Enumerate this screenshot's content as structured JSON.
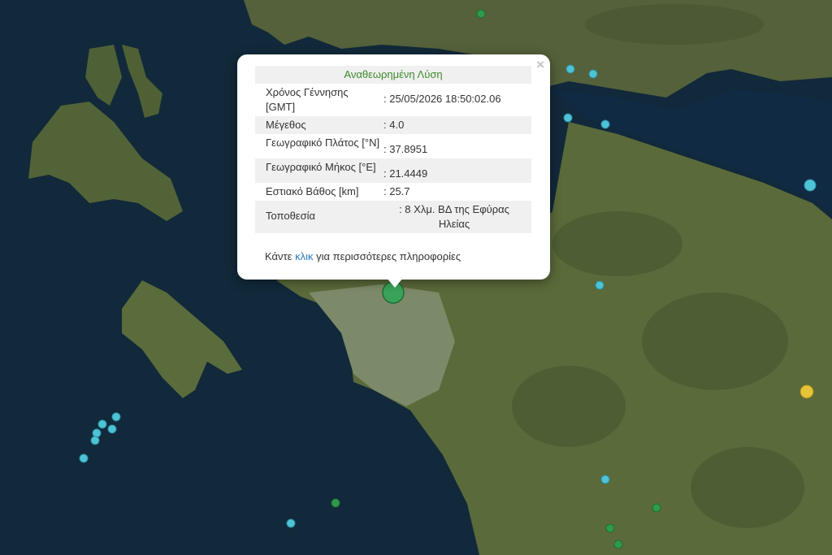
{
  "popup": {
    "title": "Αναθεωρημένη Λύση",
    "close_label": "×",
    "rows": [
      {
        "label": "Χρόνος Γέννησης [GMT]",
        "value": ": 25/05/2026 18:50:02.06"
      },
      {
        "label": "Μέγεθος",
        "value": ": 4.0"
      },
      {
        "label": "Γεωγραφικό Πλάτος [°N]",
        "value": ": 37.8951"
      },
      {
        "label": "Γεωγραφικό Μήκος [°E]",
        "value": ": 21.4449"
      },
      {
        "label": "Εστιακό Βάθος [km]",
        "value": ": 25.7"
      },
      {
        "label": "Τοποθεσία",
        "value": ": 8 Χλμ. ΒΔ της Εφύρας Ηλείας"
      }
    ],
    "more_prefix": "Κάντε",
    "more_link": "κλικ",
    "more_suffix": "για περισσότερες πληροφορίες"
  },
  "colors": {
    "sea": "#0f2a3d",
    "land": "#5b6a3c",
    "marker_recent": "#3aa35a",
    "marker_cyan": "#4fc3d6",
    "marker_green": "#2f9a4a",
    "marker_yellow": "#e6c43a"
  },
  "markers": [
    {
      "type": "main",
      "icon": "earthquake-marker-icon"
    },
    {
      "type": "cyan"
    },
    {
      "type": "cyan"
    },
    {
      "type": "cyan"
    },
    {
      "type": "cyan"
    },
    {
      "type": "cyan"
    },
    {
      "type": "cyan"
    },
    {
      "type": "cyan"
    },
    {
      "type": "cyan"
    },
    {
      "type": "cyan"
    },
    {
      "type": "cyan"
    },
    {
      "type": "cyan"
    },
    {
      "type": "cyan"
    },
    {
      "type": "cyan"
    },
    {
      "type": "cyan"
    },
    {
      "type": "green"
    },
    {
      "type": "green"
    },
    {
      "type": "green"
    },
    {
      "type": "green"
    },
    {
      "type": "yellow"
    }
  ]
}
